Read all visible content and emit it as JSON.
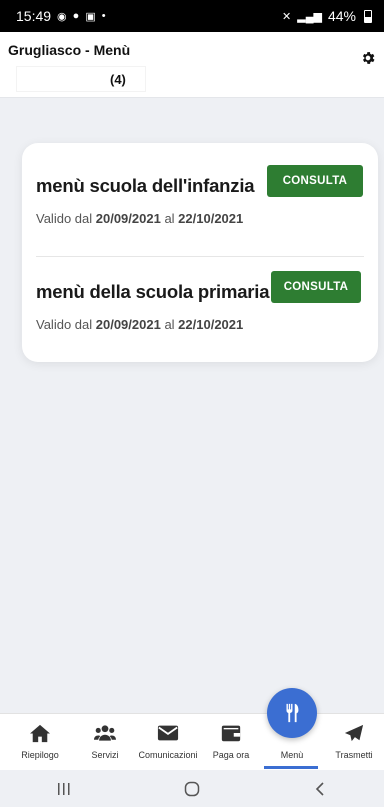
{
  "status_bar": {
    "time": "15:49",
    "battery": "44%"
  },
  "header": {
    "title": "Grugliasco - Menù",
    "count": "(4)"
  },
  "menus": [
    {
      "title": "menù scuola dell'infanzia",
      "button": "CONSULTA",
      "valid_prefix": "Valido dal ",
      "date_from": "20/09/2021",
      "valid_mid": " al ",
      "date_to": "22/10/2021"
    },
    {
      "title": "menù della scuola primaria",
      "button": "CONSULTA",
      "valid_prefix": "Valido dal ",
      "date_from": "20/09/2021",
      "valid_mid": " al ",
      "date_to": "22/10/2021"
    }
  ],
  "bottom_nav": {
    "items": [
      {
        "label": "Riepilogo",
        "icon": "home-icon"
      },
      {
        "label": "Servizi",
        "icon": "users-icon"
      },
      {
        "label": "Comunicazioni",
        "icon": "mail-icon"
      },
      {
        "label": "Paga ora",
        "icon": "wallet-icon"
      },
      {
        "label": "Menù",
        "icon": "cutlery-icon",
        "active": true
      },
      {
        "label": "Trasmetti",
        "icon": "send-icon"
      }
    ]
  },
  "colors": {
    "accent": "#3b6ed2",
    "button": "#2e7d32"
  }
}
